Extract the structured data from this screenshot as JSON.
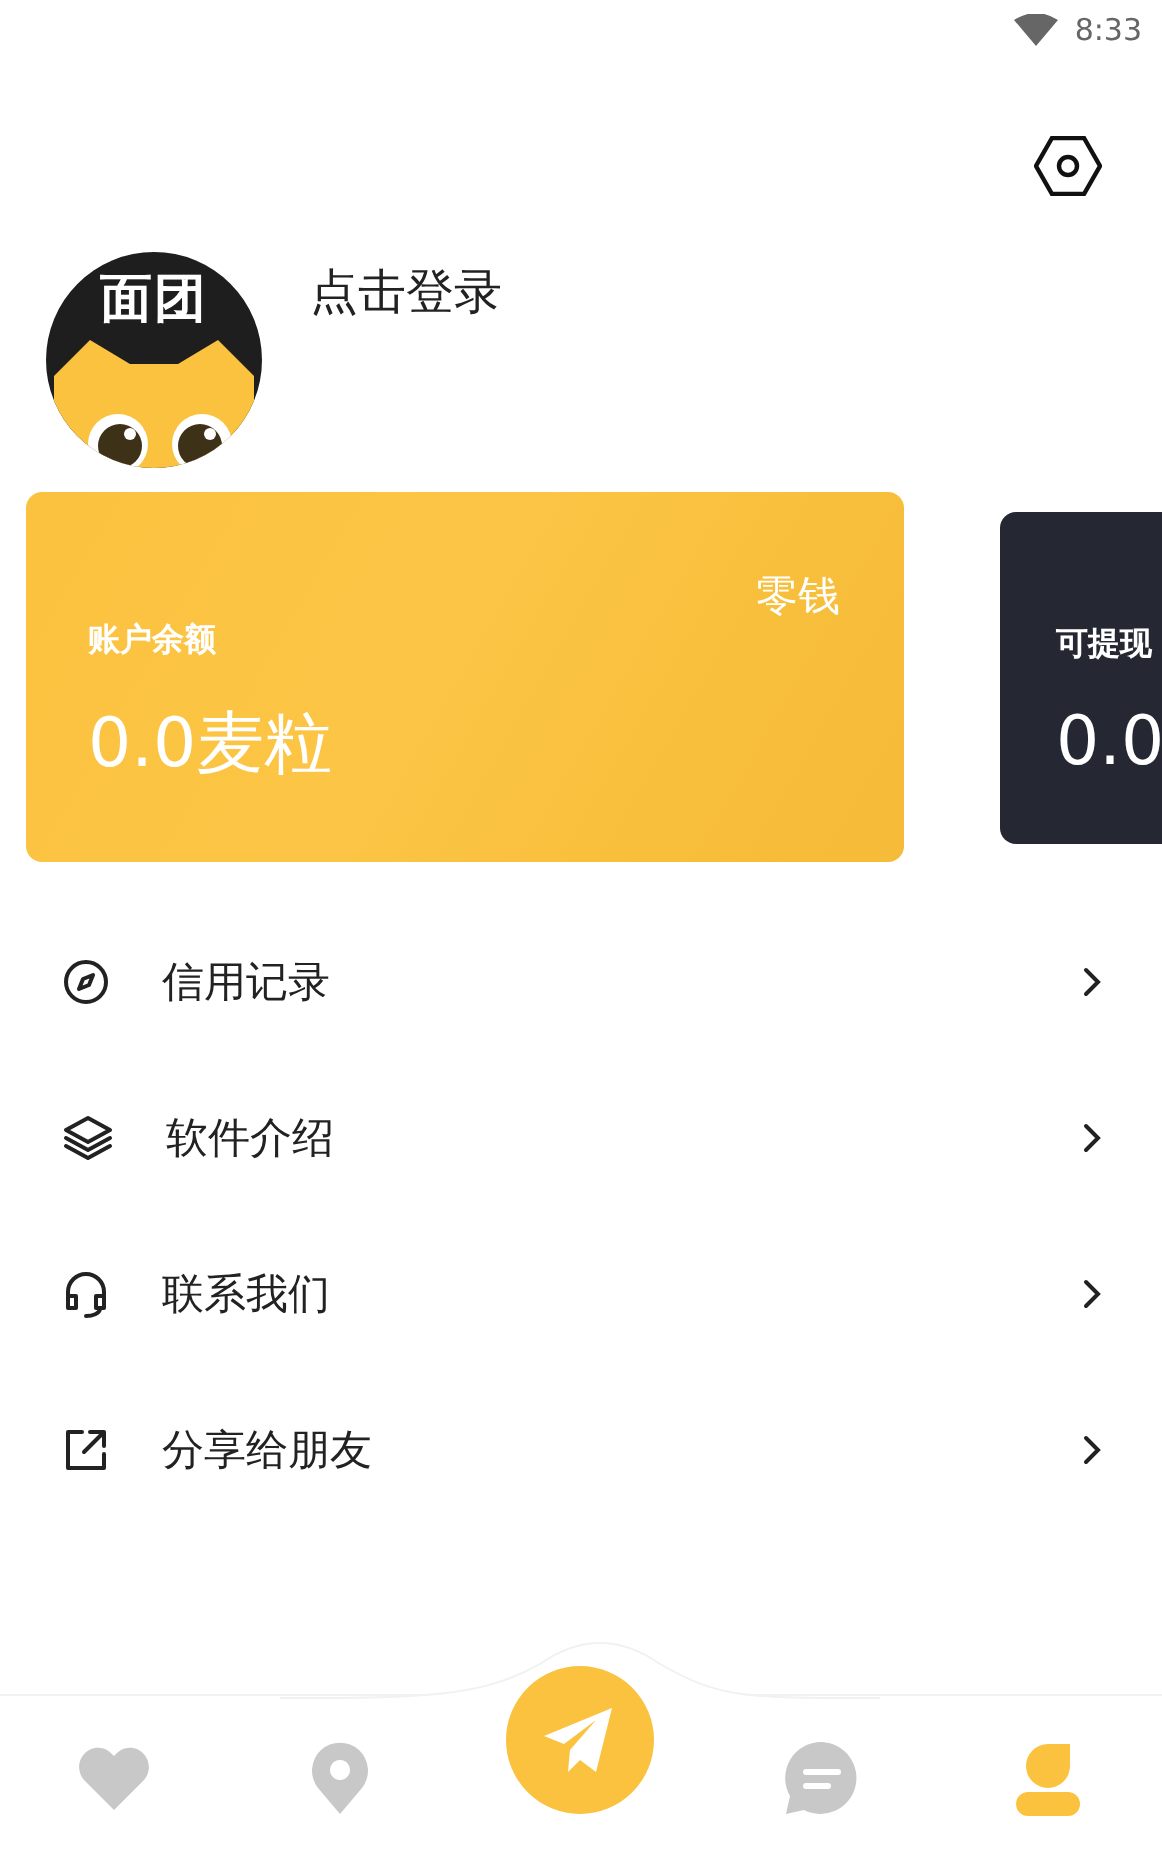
{
  "status_bar": {
    "time": "8:33"
  },
  "profile": {
    "avatar_text": "面团",
    "login": "点击登录"
  },
  "cards": [
    {
      "kind": "balance",
      "label": "账户余额",
      "value": "0.0麦粒",
      "tag": "零钱"
    },
    {
      "kind": "withdraw",
      "label": "可提现",
      "value": "0.0"
    }
  ],
  "menu": [
    {
      "kind": "credit",
      "label": "信用记录"
    },
    {
      "kind": "about",
      "label": "软件介绍"
    },
    {
      "kind": "contact",
      "label": "联系我们"
    },
    {
      "kind": "share",
      "label": "分享给朋友"
    }
  ],
  "nav": [
    {
      "kind": "heart",
      "selected": false
    },
    {
      "kind": "pin",
      "selected": false
    },
    {
      "kind": "send",
      "selected": false
    },
    {
      "kind": "chat",
      "selected": false
    },
    {
      "kind": "person",
      "selected": true
    }
  ]
}
